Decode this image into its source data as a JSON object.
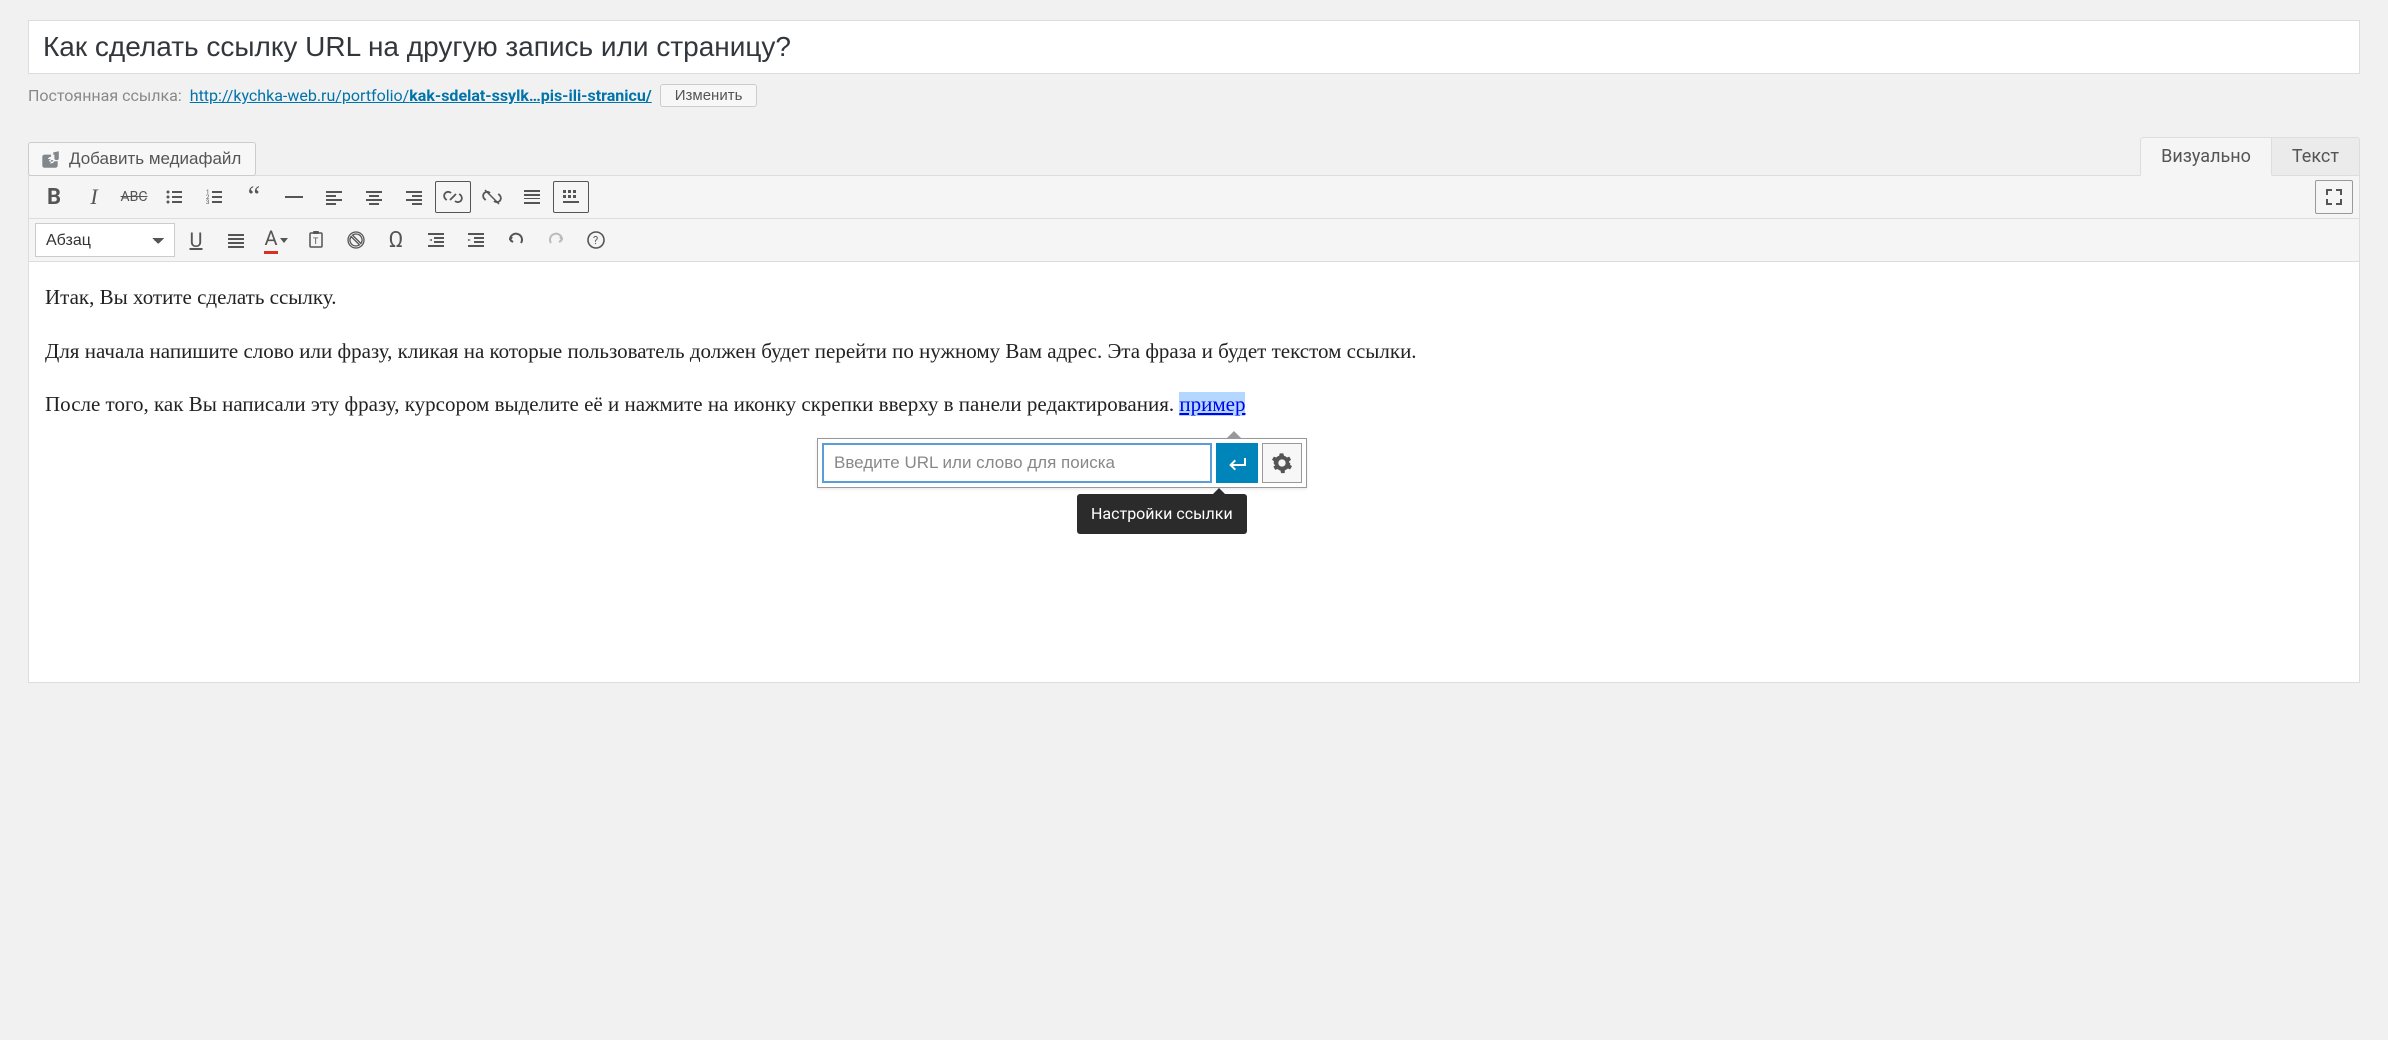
{
  "post": {
    "title": "Как сделать ссылку URL на другую запись или страницу?",
    "permalink_label": "Постоянная ссылка:",
    "permalink_base": "http://kychka-web.ru/portfolio/",
    "permalink_slug": "kak-sdelat-ssylk…pis-ili-stranicu/",
    "edit_permalink_label": "Изменить"
  },
  "buttons": {
    "add_media": "Добавить медиафайл"
  },
  "tabs": {
    "visual": "Визуально",
    "text": "Текст"
  },
  "format_dropdown": {
    "selected": "Абзац"
  },
  "content": {
    "p1": "Итак, Вы хотите сделать ссылку.",
    "p2": "Для начала напишите слово или фразу, кликая на которые пользователь должен будет перейти по нужному Вам адрес. Эта фраза и будет текстом ссылки.",
    "p3_before": "После того, как Вы написали эту фразу, курсором выделите её и нажмите на иконку скрепки вверху в панели редактирования. ",
    "p3_link": "пример"
  },
  "link_popup": {
    "url_placeholder": "Введите URL или слово для поиска",
    "tooltip": "Настройки ссылки"
  }
}
